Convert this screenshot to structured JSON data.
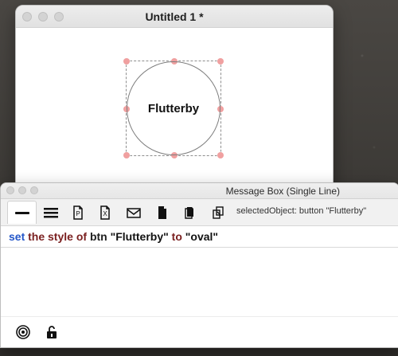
{
  "document_window": {
    "title": "Untitled 1 *",
    "selected_button_label": "Flutterby"
  },
  "message_box": {
    "title": "Message Box (Single Line)",
    "status": "selectedObject: button \"Flutterby\"",
    "command": {
      "set": "set",
      "the": "the",
      "style": "style",
      "of": "of",
      "btn": "btn",
      "target": "\"Flutterby\"",
      "to": "to",
      "value": "\"oval\""
    },
    "toolbar_icons": [
      "single-line-icon",
      "multiple-lines-icon",
      "page-p-icon",
      "page-x-icon",
      "mail-icon",
      "document-icon",
      "copy-documents-icon",
      "duplicate-icon"
    ],
    "bottom_icons": [
      "target-icon",
      "unlock-icon"
    ]
  }
}
